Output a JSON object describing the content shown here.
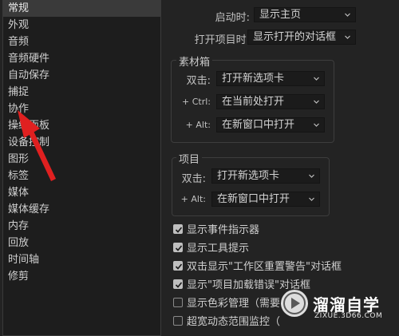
{
  "sidebar": {
    "items": [
      {
        "label": "常规",
        "selected": true
      },
      {
        "label": "外观"
      },
      {
        "label": "音频"
      },
      {
        "label": "音频硬件"
      },
      {
        "label": "自动保存"
      },
      {
        "label": "捕捉"
      },
      {
        "label": "协作"
      },
      {
        "label": "操纵面板"
      },
      {
        "label": "设备控制"
      },
      {
        "label": "图形"
      },
      {
        "label": "标签"
      },
      {
        "label": "媒体"
      },
      {
        "label": "媒体缓存"
      },
      {
        "label": "内存"
      },
      {
        "label": "回放"
      },
      {
        "label": "时间轴"
      },
      {
        "label": "修剪"
      }
    ]
  },
  "general": {
    "startup_label": "启动时:",
    "startup_value": "显示主页",
    "open_project_label": "打开项目时:",
    "open_project_value": "显示打开的对话框"
  },
  "bin": {
    "title": "素材箱",
    "double_click_label": "双击:",
    "double_click_value": "打开新选项卡",
    "ctrl_label": "+ Ctrl:",
    "ctrl_value": "在当前处打开",
    "alt_label": "+ Alt:",
    "alt_value": "在新窗口中打开"
  },
  "project": {
    "title": "项目",
    "double_click_label": "双击:",
    "double_click_value": "打开新选项卡",
    "alt_label": "+ Alt:",
    "alt_value": "在新窗口中打开"
  },
  "checkboxes": [
    {
      "label": "显示事件指示器",
      "checked": true
    },
    {
      "label": "显示工具提示",
      "checked": true
    },
    {
      "label": "双击显示\"工作区重置警告\"对话框",
      "checked": true
    },
    {
      "label": "显示\"项目加载错误\"对话框",
      "checked": true
    },
    {
      "label": "显示色彩管理（需要",
      "checked": false
    },
    {
      "label": "超宽动态范围监控（",
      "checked": false
    }
  ],
  "watermark": {
    "title": "溜溜自学",
    "url": "ZIXUE.3D66.COM"
  },
  "colors": {
    "arrow": "#e02020",
    "selected_bg": "#3a3a3a"
  }
}
